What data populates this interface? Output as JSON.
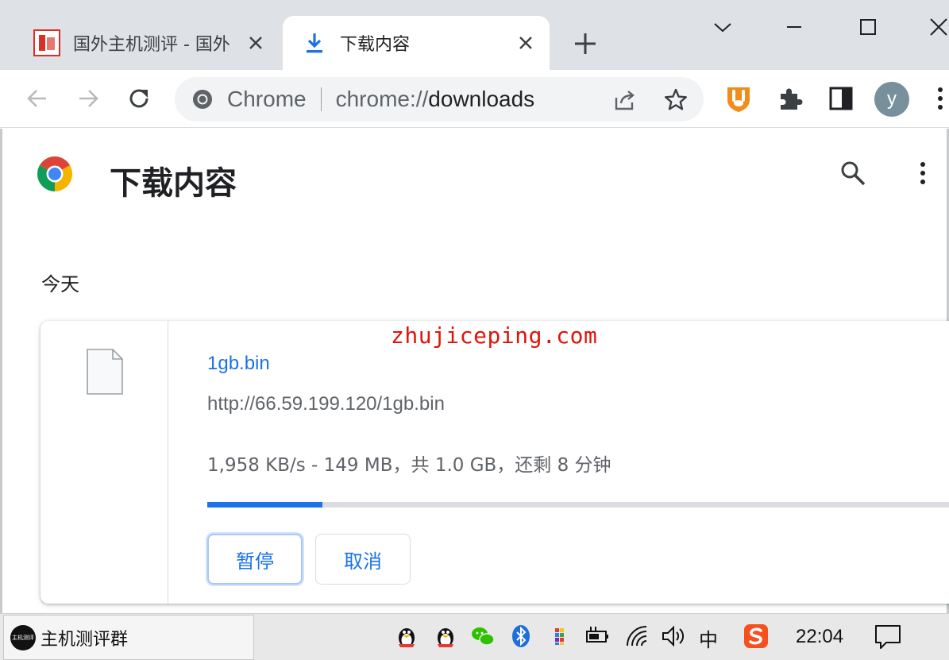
{
  "tabs": [
    {
      "title": "国外主机测评 - 国外",
      "favicon": "zhujiceping-seal-icon",
      "active": false
    },
    {
      "title": "下载内容",
      "favicon": "download-arrow-icon",
      "active": true
    }
  ],
  "window_controls": [
    "tab-search-chevron-icon",
    "minimize-icon",
    "maximize-icon",
    "close-icon"
  ],
  "omnibox": {
    "chip": "Chrome",
    "url_scheme": "chrome://",
    "url_host": "downloads"
  },
  "profile": {
    "initial": "y"
  },
  "page": {
    "title": "下载内容",
    "section_date": "今天"
  },
  "download": {
    "file_name": "1gb.bin",
    "url": "http://66.59.199.120/1gb.bin",
    "status": "1,958 KB/s - 149 MB，共 1.0 GB，还剩 8 分钟",
    "progress_fraction": 0.149,
    "pause_label": "暂停",
    "cancel_label": "取消"
  },
  "watermark": "zhujiceping.com",
  "taskbar": {
    "app_label": "主机测评群",
    "app_icon_text": "主机测评",
    "ime_label": "中",
    "clock": "22:04"
  },
  "colors": {
    "accent": "#1a73e8",
    "tabbar_bg": "#dee1e6",
    "watermark": "#e0140b",
    "avatar": "#78909c"
  }
}
